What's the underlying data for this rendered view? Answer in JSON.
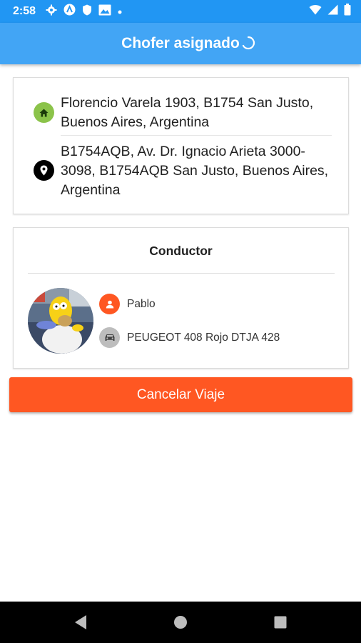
{
  "status_bar": {
    "time": "2:58",
    "left_icons": [
      "settings-icon",
      "autofill-icon",
      "shield-icon",
      "image-icon",
      "dot-icon"
    ],
    "right_icons": [
      "wifi-icon",
      "signal-icon",
      "battery-icon"
    ]
  },
  "header": {
    "title": "Chofer asignado",
    "loading": true
  },
  "route": {
    "origin": {
      "icon": "home-icon",
      "address": "Florencio Varela 1903, B1754 San Justo, Buenos Aires, Argentina",
      "color": "#8bc34a"
    },
    "destination": {
      "icon": "location-pin-icon",
      "address": "B1754AQB, Av. Dr. Ignacio Arieta 3000-3098, B1754AQB San Justo, Buenos Aires, Argentina",
      "color": "#000000"
    }
  },
  "driver": {
    "section_title": "Conductor",
    "name": "Pablo",
    "vehicle": "PEUGEOT 408 Rojo DTJA 428",
    "name_icon": "person-icon",
    "vehicle_icon": "car-icon",
    "name_icon_color": "#ff5722",
    "vehicle_icon_color": "#bdbdbd"
  },
  "actions": {
    "cancel_label": "Cancelar Viaje",
    "cancel_color": "#ff5722"
  },
  "colors": {
    "status_bar": "#2196f3",
    "header": "#42a5f5"
  },
  "nav_bar": {
    "buttons": [
      "back-icon",
      "home-circle-icon",
      "recents-icon"
    ]
  }
}
